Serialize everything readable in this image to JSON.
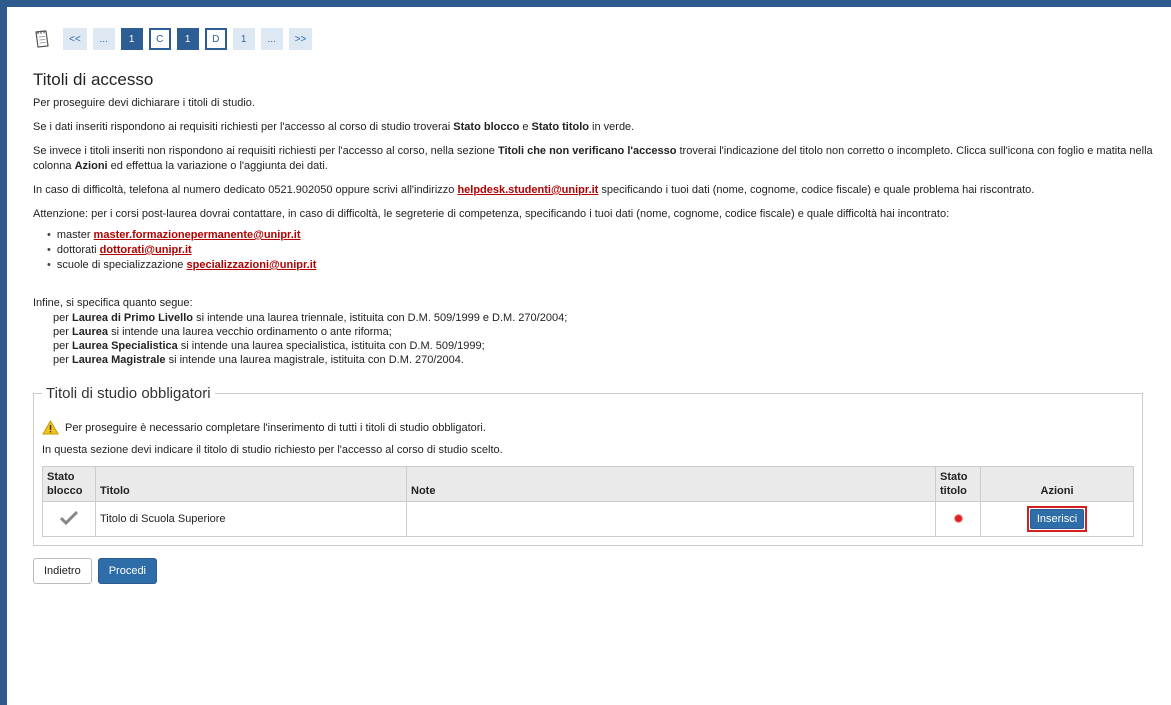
{
  "steps": {
    "items": [
      "<<",
      "...",
      "1",
      "C",
      "1",
      "D",
      "1",
      "...",
      ">>"
    ],
    "states": [
      "normal",
      "normal",
      "active",
      "outline",
      "active",
      "outline",
      "normal",
      "normal",
      "normal"
    ]
  },
  "page": {
    "title": "Titoli di accesso",
    "intro": "Per proseguire devi dichiarare i titoli di studio.",
    "p2_a": "Se i dati inseriti rispondono ai requisiti richiesti per l'accesso al corso di studio troverai ",
    "p2_b1": "Stato blocco",
    "p2_c": " e ",
    "p2_b2": "Stato titolo",
    "p2_d": " in verde.",
    "p3_a": "Se invece i titoli inseriti non rispondono ai requisiti richiesti per l'accesso al corso, nella sezione ",
    "p3_b": "Titoli che non verificano l'accesso",
    "p3_c": " troverai l'indicazione del titolo non corretto o incompleto. Clicca sull'icona con foglio e matita nella colonna ",
    "p3_d": "Azioni",
    "p3_e": " ed effettua la variazione o l'aggiunta dei dati.",
    "p4_a": "In caso di difficoltà, telefona al numero dedicato 0521.902050 oppure scrivi all'indirizzo ",
    "p4_link": "helpdesk.studenti@unipr.it",
    "p4_b": " specificando i tuoi dati (nome, cognome, codice fiscale) e quale problema hai riscontrato.",
    "p5": "Attenzione: per i corsi post-laurea dovrai contattare, in caso di difficoltà, le segreterie di competenza, specificando i tuoi dati (nome, cognome, codice fiscale) e quale difficoltà hai incontrato:",
    "contacts": [
      {
        "label": "master ",
        "email": "master.formazionepermanente@unipr.it"
      },
      {
        "label": "dottorati ",
        "email": "dottorati@unipr.it"
      },
      {
        "label": "scuole di specializzazione ",
        "email": "specializzazioni@unipr.it"
      }
    ],
    "final_intro": "Infine, si specifica quanto segue:",
    "defs": [
      {
        "pre": "per ",
        "term": "Laurea di Primo Livello",
        "desc": " si intende una laurea triennale, istituita con D.M. 509/1999 e D.M. 270/2004;"
      },
      {
        "pre": "per ",
        "term": "Laurea",
        "desc": " si intende una laurea vecchio ordinamento o ante riforma;"
      },
      {
        "pre": "per ",
        "term": "Laurea Specialistica",
        "desc": " si intende una laurea specialistica, istituita con D.M. 509/1999;"
      },
      {
        "pre": "per ",
        "term": "Laurea Magistrale",
        "desc": " si intende una laurea magistrale, istituita con D.M. 270/2004."
      }
    ]
  },
  "section": {
    "legend": "Titoli di studio obbligatori",
    "warning": "Per proseguire è necessario completare l'inserimento di tutti i titoli di studio obbligatori.",
    "info": "In questa sezione devi indicare il titolo di studio richiesto per l'accesso al corso di studio scelto.",
    "table": {
      "headers": {
        "stato_blocco_1": "Stato",
        "stato_blocco_2": "blocco",
        "titolo": "Titolo",
        "note": "Note",
        "stato_titolo_1": "Stato",
        "stato_titolo_2": "titolo",
        "azioni": "Azioni"
      },
      "rows": [
        {
          "titolo": "Titolo di Scuola Superiore",
          "note": "",
          "action": "Inserisci"
        }
      ]
    }
  },
  "nav": {
    "back": "Indietro",
    "next": "Procedi"
  },
  "colors": {
    "frame": "#2e5a8e",
    "primary": "#2f6da9",
    "link": "#b30000",
    "status_error": "#e02020",
    "highlight": "#d02020"
  }
}
